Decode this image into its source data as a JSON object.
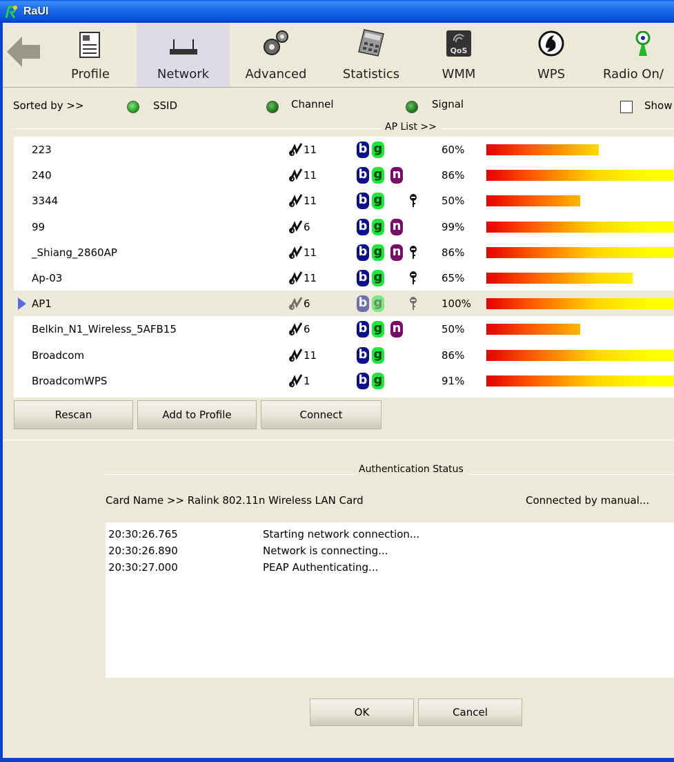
{
  "window": {
    "title": "RaUI"
  },
  "toolbar": {
    "items": [
      {
        "label": "Profile",
        "icon": "profile-icon"
      },
      {
        "label": "Network",
        "icon": "router-icon",
        "active": true
      },
      {
        "label": "Advanced",
        "icon": "gears-icon"
      },
      {
        "label": "Statistics",
        "icon": "calculator-icon"
      },
      {
        "label": "WMM",
        "icon": "qos-icon"
      },
      {
        "label": "WPS",
        "icon": "wps-icon"
      },
      {
        "label": "Radio On/",
        "icon": "radio-antenna-icon"
      }
    ]
  },
  "sort": {
    "label": "Sorted by >>",
    "options": [
      "SSID",
      "Channel",
      "Signal"
    ],
    "show_label": "Show"
  },
  "aplist": {
    "title": "AP List >>",
    "rows": [
      {
        "ssid": "223",
        "channel": "11",
        "n": false,
        "key": false,
        "signal": "60%",
        "signal_value": 60
      },
      {
        "ssid": "240",
        "channel": "11",
        "n": true,
        "key": false,
        "signal": "86%",
        "signal_value": 86
      },
      {
        "ssid": "3344",
        "channel": "11",
        "n": false,
        "key": true,
        "signal": "50%",
        "signal_value": 50
      },
      {
        "ssid": "99",
        "channel": "6",
        "n": true,
        "key": false,
        "signal": "99%",
        "signal_value": 99
      },
      {
        "ssid": "_Shiang_2860AP",
        "channel": "11",
        "n": true,
        "key": true,
        "signal": "86%",
        "signal_value": 86
      },
      {
        "ssid": "Ap-03",
        "channel": "11",
        "n": false,
        "key": true,
        "signal": "65%",
        "signal_value": 65
      },
      {
        "ssid": "AP1",
        "channel": "6",
        "n": false,
        "key": true,
        "signal": "100%",
        "signal_value": 100,
        "selected": true
      },
      {
        "ssid": "Belkin_N1_Wireless_5AFB15",
        "channel": "6",
        "n": true,
        "key": false,
        "signal": "50%",
        "signal_value": 50
      },
      {
        "ssid": "Broadcom",
        "channel": "11",
        "n": false,
        "key": false,
        "signal": "86%",
        "signal_value": 86
      },
      {
        "ssid": "BroadcomWPS",
        "channel": "1",
        "n": false,
        "key": false,
        "signal": "91%",
        "signal_value": 91
      }
    ],
    "badge_b": "b",
    "badge_g": "g",
    "badge_n": "n"
  },
  "buttons": {
    "rescan": "Rescan",
    "add_profile": "Add to Profile",
    "connect": "Connect",
    "ok": "OK",
    "cancel": "Cancel"
  },
  "auth": {
    "title": "Authentication Status",
    "card_name": "Card Name >> Ralink 802.11n Wireless LAN Card",
    "connected_by": "Connected by manual...",
    "log": [
      {
        "time": "20:30:26.765",
        "message": "Starting network connection..."
      },
      {
        "time": "20:30:26.890",
        "message": "Network is connecting..."
      },
      {
        "time": "20:30:27.000",
        "message": "PEAP Authenticating..."
      }
    ]
  },
  "colors": {
    "titlebar": "#0650d8",
    "badge_b": "#08108a",
    "badge_g": "#1ee63c",
    "badge_n": "#7a0a6a",
    "selection_arrow": "#5a6ae0"
  }
}
